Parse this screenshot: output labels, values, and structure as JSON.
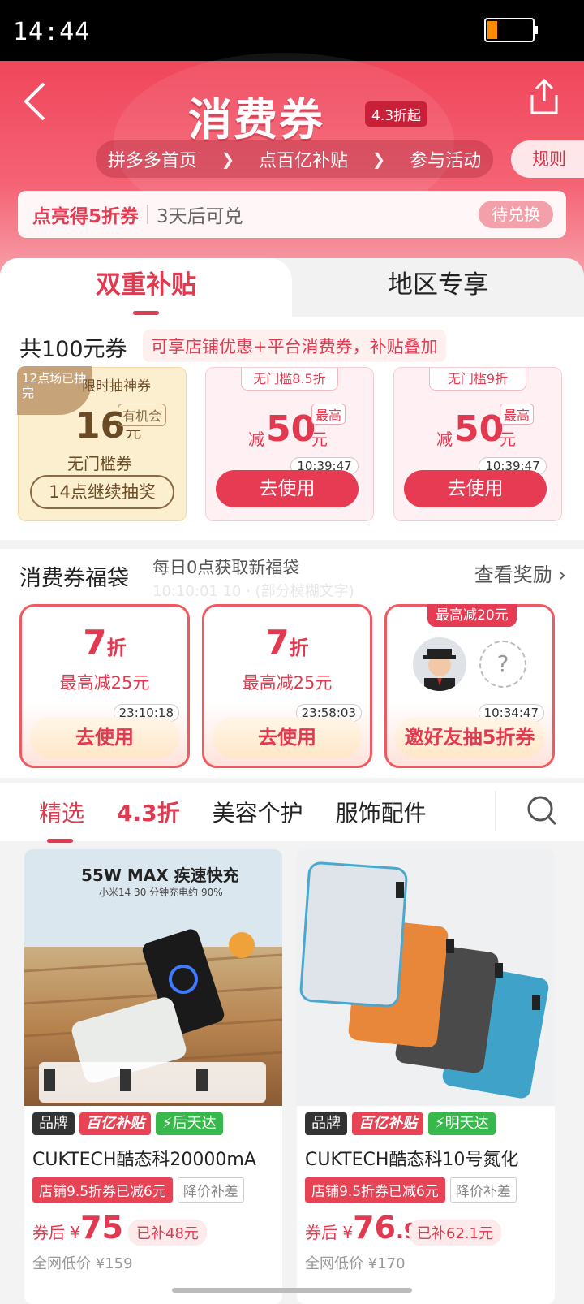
{
  "status_bar": {
    "time": "14:44"
  },
  "header": {
    "title": "消费券",
    "discount_badge": "4.3折起",
    "breadcrumbs": [
      "拼多多首页",
      "点百亿补贴",
      "参与活动"
    ],
    "rules": "规则",
    "unlock": {
      "title": "点亮得5折券",
      "note": "3天后可兑",
      "button": "待兑换"
    }
  },
  "tabs": {
    "left": "双重补贴",
    "right": "地区专享"
  },
  "coupons": {
    "total": "共100元券",
    "tag": "可享店铺优惠+平台消费券，补贴叠加",
    "lottery": {
      "ribbon": "12点场已抽完",
      "label": "限时抽神券",
      "amount": "16",
      "unit": "元",
      "chance": "有机会",
      "subtitle": "无门槛券",
      "button": "14点继续抽奖"
    },
    "items": [
      {
        "threshold": "无门槛8.5折",
        "minus": "减",
        "amount": "50",
        "unit": "元",
        "max": "最高",
        "timer": "10:39:47",
        "button": "去使用"
      },
      {
        "threshold": "无门槛9折",
        "minus": "减",
        "amount": "50",
        "unit": "元",
        "max": "最高",
        "timer": "10:39:47",
        "button": "去使用"
      }
    ]
  },
  "lucky_bag": {
    "title": "消费券福袋",
    "subtitle": "每日0点获取新福袋",
    "subtitle2": "10:10:01 10 · (部分模糊文字)",
    "view": "查看奖励",
    "bags": [
      {
        "pct": "7",
        "unit": "折",
        "desc": "最高减25元",
        "timer": "23:10:18",
        "button": "去使用"
      },
      {
        "pct": "7",
        "unit": "折",
        "desc": "最高减25元",
        "timer": "23:58:03",
        "button": "去使用"
      },
      {
        "badge": "最高减20元",
        "qmark": "?",
        "timer": "10:34:47",
        "button": "邀好友抽5折券"
      }
    ]
  },
  "categories": [
    "精选",
    "4.3折",
    "美容个护",
    "服饰配件"
  ],
  "products": [
    {
      "img_headline": "55W MAX 疾速快充",
      "img_sub": "小米14 30 分钟充电约 90%",
      "tags": [
        "品牌",
        "百亿补贴",
        "⚡后天达"
      ],
      "name": "CUKTECH酷态科20000mA",
      "shop_tag": "店铺9.5折券已减6元",
      "diff_tag": "降价补差",
      "price_prefix": "券后 ¥",
      "price_int": "75",
      "price_dec": "",
      "subsidy": "已补48元",
      "low": "全网低价 ¥159"
    },
    {
      "img_headline": "",
      "img_sub": "",
      "tags": [
        "品牌",
        "百亿补贴",
        "⚡明天达"
      ],
      "name": "CUKTECH酷态科10号氮化",
      "shop_tag": "店铺9.5折券已减6元",
      "diff_tag": "降价补差",
      "price_prefix": "券后 ¥",
      "price_int": "76",
      "price_dec": ".9",
      "subsidy": "已补62.1元",
      "low": "全网低价 ¥170"
    }
  ],
  "colors": {
    "accent": "#e13a50",
    "hero_top": "#f0465b",
    "gold": "#6b4a26"
  }
}
